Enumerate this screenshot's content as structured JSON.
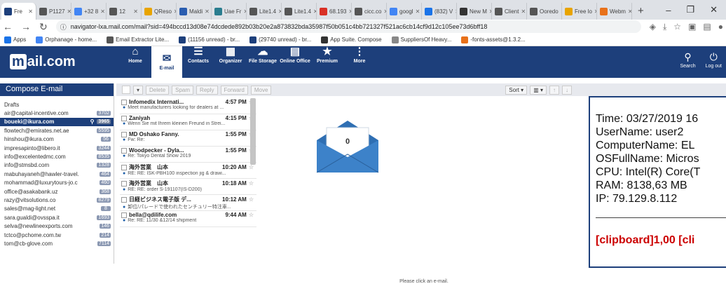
{
  "browser": {
    "tabs": [
      {
        "label": "Fre",
        "color": "#1d3f7b"
      },
      {
        "label": "P1127",
        "color": "#555"
      },
      {
        "label": "+32 8",
        "color": "#4285f4"
      },
      {
        "label": "12",
        "color": "#555"
      },
      {
        "label": "QReso",
        "color": "#e8a400"
      },
      {
        "label": "Maldi",
        "color": "#2a5db0"
      },
      {
        "label": "Uae Fr",
        "color": "#2a7d8f"
      },
      {
        "label": "Lite1.4",
        "color": "#555"
      },
      {
        "label": "Lite1.4",
        "color": "#555"
      },
      {
        "label": "68.193",
        "color": "#d93025"
      },
      {
        "label": "cicc.co",
        "color": "#555"
      },
      {
        "label": "googl",
        "color": "#4285f4"
      },
      {
        "label": "(832) V",
        "color": "#1a73e8"
      },
      {
        "label": "New M",
        "color": "#333"
      },
      {
        "label": "Client",
        "color": "#555"
      },
      {
        "label": "Ooredo",
        "color": "#555"
      },
      {
        "label": "Free lo",
        "color": "#e8a400"
      },
      {
        "label": "Webm",
        "color": "#e8711a"
      }
    ],
    "new_tab": "+",
    "url": "navigator-lxa.mail.com/mail?sid=494bccd13d08e74dcdede892b03b20e2a873832bda35987f50b051c4bb721327f521ac6cb14cf9d12c105ee73d6bff18",
    "bookmarks": [
      "Apps",
      "Orphanage - home...",
      "Email Extractor Lite...",
      "(11156 unread) - br...",
      "(29740 unread) - br...",
      "App Suite. Compose",
      "SuppliersOf Heavy...",
      "-fonts-assets@1.3.2..."
    ]
  },
  "mail": {
    "logo": "mail.com",
    "nav": [
      "Home",
      "E-mail",
      "Contacts",
      "Organizer",
      "File Storage",
      "Online Office",
      "Premium",
      "More"
    ],
    "right_nav": [
      "Search",
      "Log out"
    ],
    "compose": "Compose E-mail",
    "folders": [
      {
        "name": "Drafts",
        "count": ""
      },
      {
        "name": "air@capital-incentive.com",
        "count": "3702"
      },
      {
        "name": "boueki@ikura.com",
        "count": "3965"
      },
      {
        "name": "flowtech@emirates.net.ae",
        "count": "5595"
      },
      {
        "name": "hinshou@ikura.com",
        "count": "56"
      },
      {
        "name": "impresapinto@libero.it",
        "count": "3244"
      },
      {
        "name": "info@excelentedmc.com",
        "count": "8535"
      },
      {
        "name": "info@stmsbd.com",
        "count": "1328"
      },
      {
        "name": "mabuhayaneh@hawler-travel.",
        "count": "464"
      },
      {
        "name": "mohammad@luxurytours-jo.c",
        "count": "460"
      },
      {
        "name": "office@asakabank.uz",
        "count": "368"
      },
      {
        "name": "razy@vitsolutions.co",
        "count": "8279"
      },
      {
        "name": "sales@mag-light.net",
        "count": "8"
      },
      {
        "name": "sara.gualdi@ovsspa.it",
        "count": "1693"
      },
      {
        "name": "selva@newlineexports.com",
        "count": "146"
      },
      {
        "name": "tctco@pchome.com.tw",
        "count": "214"
      },
      {
        "name": "tom@cb-glove.com",
        "count": "7114"
      }
    ],
    "toolbar": [
      "Delete",
      "Spam",
      "Reply",
      "Forward",
      "Move"
    ],
    "sort": "Sort",
    "messages": [
      {
        "from": "Infomedix Internati...",
        "time": "4:57 PM",
        "subject": "Meet manufacturers looking for dealers at ..."
      },
      {
        "from": "Zaniyah",
        "time": "4:15 PM",
        "subject": "Wenn Sie mit Ihrem kleinen Freund in Strei..."
      },
      {
        "from": "MD Oshako Fanny.",
        "time": "1:55 PM",
        "subject": "Fw: Re:"
      },
      {
        "from": "Woodpecker - Dyla...",
        "time": "1:55 PM",
        "subject": "Re: Tokyo Dental Show 2019"
      },
      {
        "from": "海外営業　山本",
        "time": "10:20 AM",
        "subject": "RE: RE: ISK-PBH100 inspection jig & drawi..."
      },
      {
        "from": "海外営業　山本",
        "time": "10:18 AM",
        "subject": "RE: RE: order S-191107(IS-D200)"
      },
      {
        "from": "日経ビジネス電子版 デ...",
        "time": "10:12 AM",
        "subject": "卸位/パレードで使われたセンチュリー特注車..."
      },
      {
        "from": "bella@qdilife.com",
        "time": "9:44 AM",
        "subject": "Re: RE: 11/30 &12/14 shipment"
      }
    ],
    "preview_count": "0",
    "preview_text": "Please click an e-mail."
  },
  "overlay": {
    "lines": [
      "Time: 03/27/2019 16",
      "UserName: user2",
      "ComputerName: EL",
      "OSFullName: Micros",
      "CPU: Intel(R) Core(T",
      "RAM: 8138,63 MB",
      "IP: 79.129.8.112"
    ],
    "clip": "[clipboard]1,00 [cli"
  }
}
